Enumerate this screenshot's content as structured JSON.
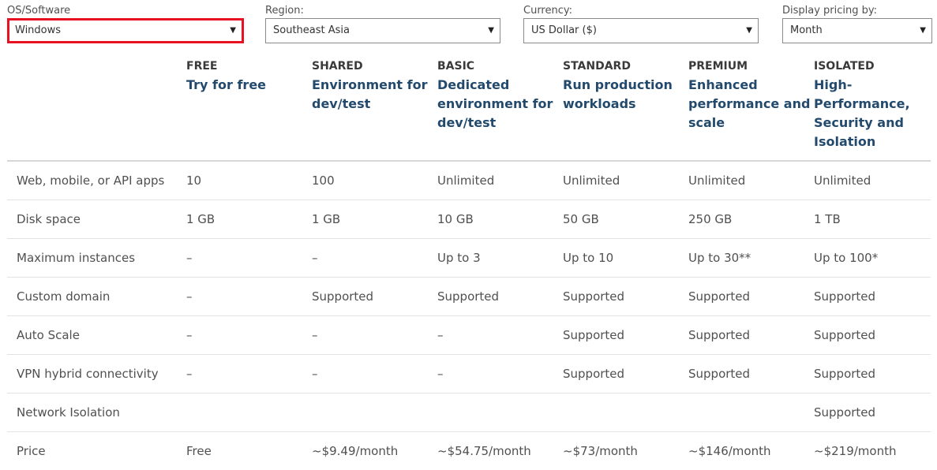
{
  "filters": [
    {
      "label": "OS/Software",
      "value": "Windows"
    },
    {
      "label": "Region:",
      "value": "Southeast Asia"
    },
    {
      "label": "Currency:",
      "value": "US Dollar ($)"
    },
    {
      "label": "Display pricing by:",
      "value": "Month"
    }
  ],
  "dropdown_icon": "triangle-down",
  "highlight_color": "#e81123",
  "tiers": [
    {
      "name": "FREE",
      "desc": "Try for free"
    },
    {
      "name": "SHARED",
      "desc": "Environment for dev/test"
    },
    {
      "name": "BASIC",
      "desc": "Dedicated environment for dev/test"
    },
    {
      "name": "STANDARD",
      "desc": "Run production workloads"
    },
    {
      "name": "PREMIUM",
      "desc": "Enhanced performance and scale"
    },
    {
      "name": "ISOLATED",
      "desc": "High-Performance, Security and Isolation"
    }
  ],
  "rows": [
    {
      "feature": "Web, mobile, or API apps",
      "values": [
        "10",
        "100",
        "Unlimited",
        "Unlimited",
        "Unlimited",
        "Unlimited"
      ]
    },
    {
      "feature": "Disk space",
      "values": [
        "1 GB",
        "1 GB",
        "10 GB",
        "50 GB",
        "250 GB",
        "1 TB"
      ]
    },
    {
      "feature": "Maximum instances",
      "values": [
        "–",
        "–",
        "Up to 3",
        "Up to 10",
        "Up to 30**",
        "Up to 100*"
      ]
    },
    {
      "feature": "Custom domain",
      "values": [
        "–",
        "Supported",
        "Supported",
        "Supported",
        "Supported",
        "Supported"
      ]
    },
    {
      "feature": "Auto Scale",
      "values": [
        "–",
        "–",
        "–",
        "Supported",
        "Supported",
        "Supported"
      ]
    },
    {
      "feature": "VPN hybrid connectivity",
      "values": [
        "–",
        "–",
        "–",
        "Supported",
        "Supported",
        "Supported"
      ]
    },
    {
      "feature": "Network Isolation",
      "values": [
        "",
        "",
        "",
        "",
        "",
        "Supported"
      ]
    },
    {
      "feature": "Price",
      "values": [
        "Free",
        "~$9.49/month",
        "~$54.75/month",
        "~$73/month",
        "~$146/month",
        "~$219/month"
      ]
    }
  ]
}
